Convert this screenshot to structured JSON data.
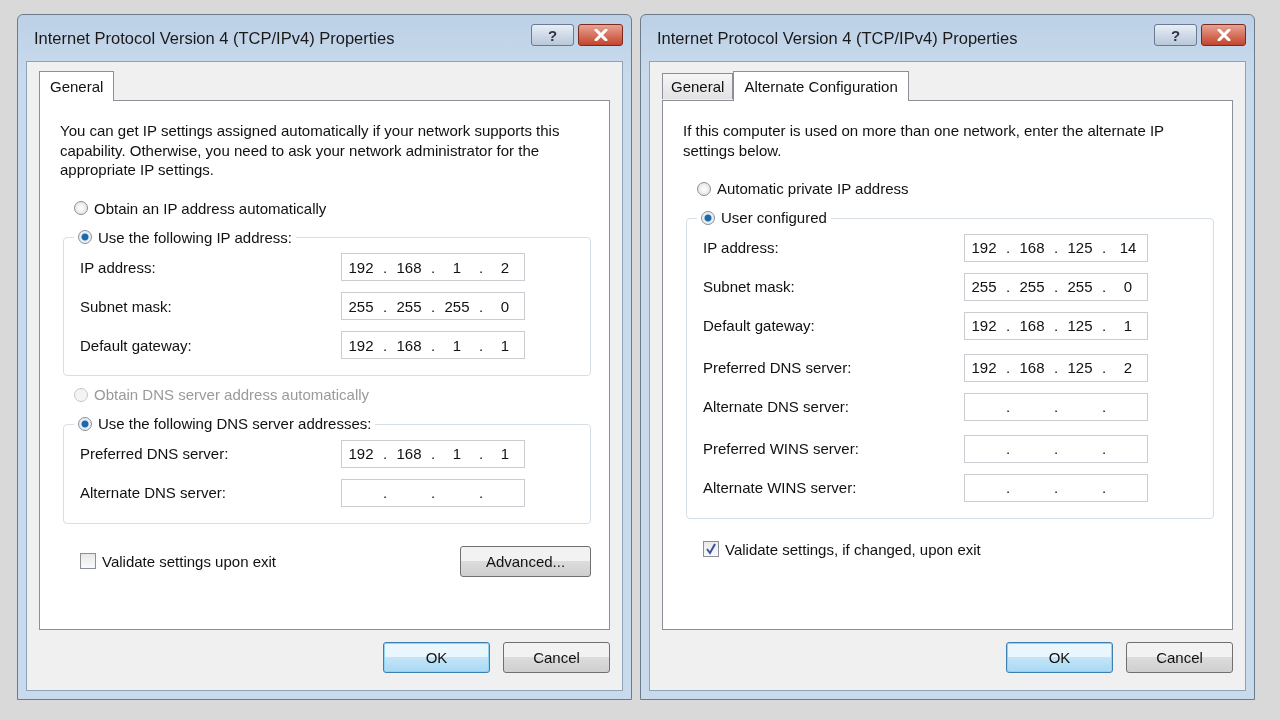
{
  "dialogs": [
    {
      "title": "Internet Protocol Version 4 (TCP/IPv4) Properties",
      "help_button": "?",
      "tabs": [
        {
          "label": "General",
          "selected": true
        }
      ],
      "description": "You can get IP settings assigned automatically if your network supports this capability. Otherwise, you need to ask your network administrator for the appropriate IP settings.",
      "sections": [
        {
          "options": [
            {
              "label": "Obtain an IP address automatically",
              "selected": false,
              "disabled": false
            },
            {
              "label": "Use the following IP address:",
              "selected": true,
              "disabled": false
            }
          ],
          "field_groups": [
            [
              {
                "label": "IP address:",
                "octets": [
                  "192",
                  "168",
                  "1",
                  "2"
                ],
                "dots": [
                  ".",
                  ".",
                  "."
                ]
              },
              {
                "label": "Subnet mask:",
                "octets": [
                  "255",
                  "255",
                  "255",
                  "0"
                ],
                "dots": [
                  ".",
                  ".",
                  "."
                ]
              },
              {
                "label": "Default gateway:",
                "octets": [
                  "192",
                  "168",
                  "1",
                  "1"
                ],
                "dots": [
                  ".",
                  ".",
                  "."
                ]
              }
            ]
          ]
        },
        {
          "options": [
            {
              "label": "Obtain DNS server address automatically",
              "selected": false,
              "disabled": true
            },
            {
              "label": "Use the following DNS server addresses:",
              "selected": true,
              "disabled": false
            }
          ],
          "field_groups": [
            [
              {
                "label": "Preferred DNS server:",
                "octets": [
                  "192",
                  "168",
                  "1",
                  "1"
                ],
                "dots": [
                  ".",
                  ".",
                  "."
                ]
              },
              {
                "label": "Alternate DNS server:",
                "dots": [
                  ".",
                  ".",
                  "."
                ]
              }
            ]
          ]
        }
      ],
      "validate": {
        "label": "Validate settings upon exit",
        "checked": false
      },
      "advanced_button": "Advanced...",
      "buttons": [
        {
          "label": "OK",
          "default": true
        },
        {
          "label": "Cancel",
          "default": false
        }
      ]
    },
    {
      "title": "Internet Protocol Version 4 (TCP/IPv4) Properties",
      "help_button": "?",
      "tabs": [
        {
          "label": "General",
          "selected": false
        },
        {
          "label": "Alternate Configuration",
          "selected": true
        }
      ],
      "description": "If this computer is used on more than one network, enter the alternate IP settings below.",
      "sections": [
        {
          "options": [
            {
              "label": "Automatic private IP address",
              "selected": false,
              "disabled": false
            },
            {
              "label": "User configured",
              "selected": true,
              "disabled": false
            }
          ],
          "field_groups": [
            [
              {
                "label": "IP address:",
                "octets": [
                  "192",
                  "168",
                  "125",
                  "14"
                ],
                "dots": [
                  ".",
                  ".",
                  "."
                ]
              },
              {
                "label": "Subnet mask:",
                "octets": [
                  "255",
                  "255",
                  "255",
                  "0"
                ],
                "dots": [
                  ".",
                  ".",
                  "."
                ]
              },
              {
                "label": "Default gateway:",
                "octets": [
                  "192",
                  "168",
                  "125",
                  "1"
                ],
                "dots": [
                  ".",
                  ".",
                  "."
                ]
              }
            ],
            [
              {
                "label": "Preferred DNS server:",
                "octets": [
                  "192",
                  "168",
                  "125",
                  "2"
                ],
                "dots": [
                  ".",
                  ".",
                  "."
                ]
              },
              {
                "label": "Alternate DNS server:",
                "dots": [
                  ".",
                  ".",
                  "."
                ]
              }
            ],
            [
              {
                "label": "Preferred WINS server:",
                "dots": [
                  ".",
                  ".",
                  "."
                ]
              },
              {
                "label": "Alternate WINS server:",
                "dots": [
                  ".",
                  ".",
                  "."
                ]
              }
            ]
          ]
        }
      ],
      "validate": {
        "label": "Validate settings, if changed, upon exit",
        "checked": true
      },
      "buttons": [
        {
          "label": "OK",
          "default": true
        },
        {
          "label": "Cancel",
          "default": false
        }
      ]
    }
  ]
}
